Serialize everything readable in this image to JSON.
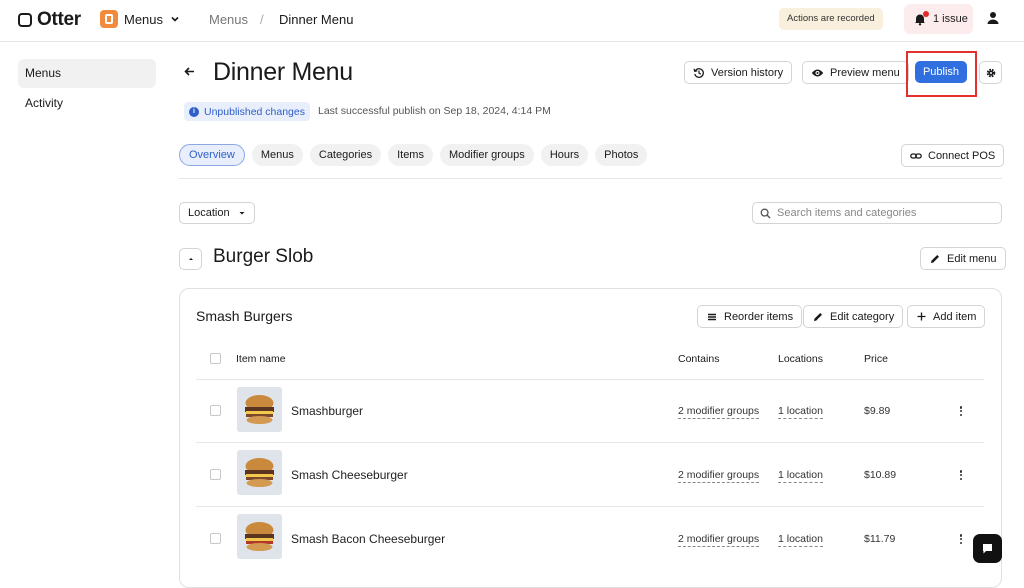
{
  "topbar": {
    "logo_text": "Otter",
    "app_label": "Menus",
    "breadcrumb": [
      "Menus",
      "/",
      "Dinner Menu"
    ],
    "recording_badge": "Actions are recorded",
    "issues_label": "1 issue"
  },
  "sidebar": {
    "items": [
      {
        "label": "Menus",
        "active": true
      },
      {
        "label": "Activity",
        "active": false
      }
    ]
  },
  "header": {
    "title": "Dinner Menu",
    "version_history": "Version history",
    "preview_menu": "Preview menu",
    "publish": "Publish",
    "status_pill": "Unpublished changes",
    "status_text": "Last successful publish on Sep 18, 2024, 4:14 PM"
  },
  "tabs": [
    {
      "label": "Overview",
      "active": true
    },
    {
      "label": "Menus"
    },
    {
      "label": "Categories"
    },
    {
      "label": "Items"
    },
    {
      "label": "Modifier groups"
    },
    {
      "label": "Hours"
    },
    {
      "label": "Photos"
    }
  ],
  "connect_pos": "Connect POS",
  "filters": {
    "location_label": "Location",
    "search_placeholder": "Search items and categories"
  },
  "menu_section": {
    "name": "Burger Slob",
    "edit_menu": "Edit menu"
  },
  "category": {
    "name": "Smash Burgers",
    "reorder_items": "Reorder items",
    "edit_category": "Edit category",
    "add_item": "Add item"
  },
  "table": {
    "headers": {
      "item_name": "Item name",
      "contains": "Contains",
      "locations": "Locations",
      "price": "Price"
    },
    "rows": [
      {
        "name": "Smashburger",
        "contains": "2 modifier groups",
        "locations": "1 location",
        "price": "$9.89"
      },
      {
        "name": "Smash Cheeseburger",
        "contains": "2 modifier groups",
        "locations": "1 location",
        "price": "$10.89"
      },
      {
        "name": "Smash Bacon Cheeseburger",
        "contains": "2 modifier groups",
        "locations": "1 location",
        "price": "$11.79"
      }
    ]
  },
  "colors": {
    "primary": "#2f6fe0",
    "accent_app": "#f28a3c",
    "highlight": "#e0312f",
    "notification_dot": "#e02b2b"
  }
}
